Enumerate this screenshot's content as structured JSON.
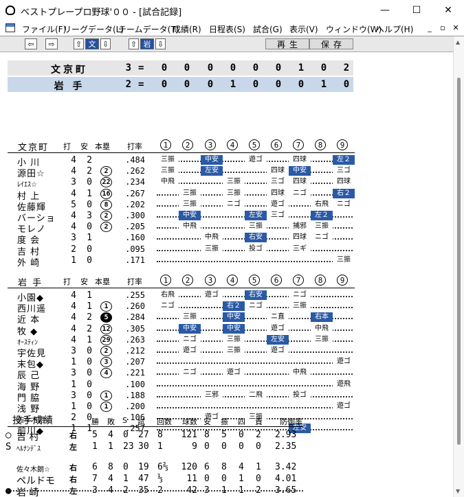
{
  "window": {
    "title": "ベストプレープロ野球'００ - [試合記録]",
    "controls": {
      "minimize": "—",
      "maximize": "☐",
      "close": "✕"
    }
  },
  "menu": [
    "ファイル(F)",
    "リーグデータ(L)",
    "チームデータ(T)",
    "成績(R)",
    "日程表(S)",
    "試合(G)",
    "表示(V)",
    "ウィンドウ(W)",
    "ヘルプ(H)"
  ],
  "mdi": {
    "minimize": "_",
    "restore": "▫",
    "close": "✕"
  },
  "toolbar": {
    "back": "⇦",
    "forward": "⇨",
    "up1": "⇧",
    "team1": "文",
    "down1": "⇩",
    "up2": "⇧",
    "team2": "岩",
    "down2": "⇩",
    "play": "再生",
    "save": "保存"
  },
  "scoreboard": [
    {
      "team": "文京町",
      "total": "3",
      "eq": "=",
      "innings": [
        "0",
        "0",
        "0",
        "0",
        "0",
        "0",
        "1",
        "0",
        "2"
      ]
    },
    {
      "team": "岩 手",
      "total": "2",
      "eq": "=",
      "innings": [
        "0",
        "0",
        "0",
        "1",
        "0",
        "0",
        "0",
        "1",
        "0"
      ]
    }
  ],
  "batting_headers": {
    "ab": "打",
    "h": "安",
    "hr": "本塁",
    "avg": "打率"
  },
  "inning_circles": [
    "1",
    "2",
    "3",
    "4",
    "5",
    "6",
    "7",
    "8",
    "9"
  ],
  "teams": [
    {
      "name": "文京町",
      "players": [
        {
          "name": "小 川",
          "ab": "4",
          "h": "2",
          "hr": "",
          "avg": ".484",
          "abs": [
            [
              "三振",
              0
            ],
            [
              "中安",
              1
            ],
            [
              "遊ゴ",
              0
            ],
            [
              "四球",
              0
            ],
            [
              "左２",
              1
            ]
          ]
        },
        {
          "name": "源田☆",
          "ab": "4",
          "h": "2",
          "hr": "2",
          "avg": ".262",
          "abs": [
            [
              "三振",
              0
            ],
            [
              "左安",
              1
            ],
            [
              "四球",
              0
            ],
            [
              "中安",
              1
            ],
            [
              "三ゴ",
              0
            ]
          ]
        },
        {
          "name": "ﾚｲｴｽ☆",
          "ab": "3",
          "h": "0",
          "hr": "22",
          "avg": ".234",
          "abs": [
            [
              "中飛",
              0
            ],
            [
              "三振",
              0
            ],
            [
              "三ゴ",
              0
            ],
            [
              "四球",
              0
            ],
            [
              "四球",
              0
            ]
          ]
        },
        {
          "name": "村 上",
          "ab": "4",
          "h": "1",
          "hr": "16",
          "avg": ".267",
          "abs": [
            [
              "三振",
              0
            ],
            [
              "三振",
              0
            ],
            [
              "四球",
              0
            ],
            [
              "ニゴ",
              0
            ],
            [
              "右２",
              1
            ]
          ]
        },
        {
          "name": "佐藤輝",
          "ab": "5",
          "h": "0",
          "hr": "8",
          "avg": ".202",
          "abs": [
            [
              "三振",
              0
            ],
            [
              "ニゴ",
              0
            ],
            [
              "遊ゴ",
              0
            ],
            [
              "右飛",
              0
            ],
            [
              "ニゴ",
              0
            ]
          ]
        },
        {
          "name": "バーショ",
          "ab": "4",
          "h": "3",
          "hr": "2",
          "avg": ".300",
          "abs": [
            [
              "中安",
              1
            ],
            [
              "左安",
              1
            ],
            [
              "三ゴ",
              0
            ],
            [
              "左２",
              1
            ]
          ]
        },
        {
          "name": "モレノ",
          "ab": "4",
          "h": "0",
          "hr": "2",
          "avg": ".205",
          "abs": [
            [
              "中飛",
              0
            ],
            [
              "三振",
              0
            ],
            [
              "捕邪",
              0
            ],
            [
              "三振",
              0
            ]
          ]
        },
        {
          "name": "度 会",
          "ab": "3",
          "h": "1",
          "hr": "",
          "avg": ".160",
          "abs": [
            [
              "中飛",
              0
            ],
            [
              "右安",
              1
            ],
            [
              "四球",
              0
            ],
            [
              "ニゴ",
              0
            ]
          ]
        },
        {
          "name": "吉 村",
          "ab": "2",
          "h": "0",
          "hr": "",
          "avg": ".095",
          "abs": [
            [
              "三振",
              0
            ],
            [
              "投ゴ",
              0
            ],
            [
              "三ギ",
              0
            ]
          ]
        },
        {
          "name": "外 崎",
          "ab": "1",
          "h": "0",
          "hr": "",
          "avg": ".171",
          "abs": [
            [
              "三振",
              0
            ]
          ]
        }
      ]
    },
    {
      "name": "岩 手",
      "players": [
        {
          "name": "小園◆",
          "ab": "4",
          "h": "1",
          "hr": "",
          "avg": ".255",
          "abs": [
            [
              "右飛",
              0
            ],
            [
              "遊ゴ",
              0
            ],
            [
              "右安",
              1
            ],
            [
              "ニゴ",
              0
            ]
          ]
        },
        {
          "name": "西川遥",
          "ab": "4",
          "h": "1",
          "hr": "1",
          "avg": ".260",
          "abs": [
            [
              "ニゴ",
              0
            ],
            [
              "右２",
              1
            ],
            [
              "ニゴ",
              0
            ],
            [
              "三振",
              0
            ]
          ]
        },
        {
          "name": "近 本",
          "ab": "4",
          "h": "2",
          "hr": "5",
          "avg": ".284",
          "abs": [
            [
              "三振",
              0
            ],
            [
              "中安",
              1
            ],
            [
              "ニ直",
              0
            ],
            [
              "右本",
              1
            ]
          ]
        },
        {
          "name": "牧 ◆",
          "ab": "4",
          "h": "2",
          "hr": "12",
          "avg": ".305",
          "abs": [
            [
              "中安",
              1
            ],
            [
              "中安",
              1
            ],
            [
              "遊ゴ",
              0
            ],
            [
              "中飛",
              0
            ]
          ]
        },
        {
          "name": "ｵｰｽﾃｨﾝ",
          "ab": "4",
          "h": "1",
          "hr": "29",
          "avg": ".263",
          "abs": [
            [
              "ニゴ",
              0
            ],
            [
              "三振",
              0
            ],
            [
              "左安",
              1
            ],
            [
              "三振",
              0
            ]
          ]
        },
        {
          "name": "宇佐見",
          "ab": "3",
          "h": "0",
          "hr": "2",
          "avg": ".212",
          "abs": [
            [
              "遊ゴ",
              0
            ],
            [
              "三振",
              0
            ],
            [
              "遊ゴ",
              0
            ]
          ]
        },
        {
          "name": "末包◆",
          "ab": "1",
          "h": "0",
          "hr": "3",
          "avg": ".207",
          "abs": [
            [
              "遊ゴ",
              0
            ]
          ]
        },
        {
          "name": "辰 己",
          "ab": "3",
          "h": "0",
          "hr": "4",
          "avg": ".221",
          "abs": [
            [
              "ニゴ",
              0
            ],
            [
              "遊ゴ",
              0
            ],
            [
              "中飛",
              0
            ]
          ]
        },
        {
          "name": "海 野",
          "ab": "1",
          "h": "0",
          "hr": "",
          "avg": ".100",
          "abs": [
            [
              "遊飛",
              0
            ]
          ]
        },
        {
          "name": "門 脇",
          "ab": "3",
          "h": "0",
          "hr": "1",
          "avg": ".188",
          "abs": [
            [
              "三邪",
              0
            ],
            [
              "二飛",
              0
            ],
            [
              "投ゴ",
              0
            ]
          ]
        },
        {
          "name": "浅 野",
          "ab": "1",
          "h": "0",
          "hr": "1",
          "avg": ".200",
          "abs": [
            [
              "遊ゴ",
              0
            ]
          ]
        },
        {
          "name": "佐々木朗☆",
          "ab": "2",
          "h": "0",
          "hr": "",
          "avg": ".106",
          "abs": [
            [
              "遊ゴ",
              0
            ],
            [
              "三振",
              0
            ]
          ]
        },
        {
          "name": "前川◆",
          "ab": "1",
          "h": "1",
          "hr": "",
          "avg": ".257",
          "abs": [
            [
              "左安",
              1
            ]
          ]
        }
      ]
    }
  ],
  "pitching": {
    "title": "投手成績",
    "headers": [
      "勝",
      "敗",
      "S",
      "試",
      "回数",
      "球数",
      "安",
      "振",
      "四",
      "責",
      "防御率"
    ],
    "rows": [
      {
        "mark": "○",
        "name": "吉 村",
        "hand": "右",
        "vals": [
          "5",
          "4",
          "0",
          "27",
          "8",
          "121",
          "8",
          "5",
          "0",
          "2",
          "2.93"
        ]
      },
      {
        "mark": "S",
        "name": "ﾍﾙﾅﾝﾃﾞｽ",
        "hand": "左",
        "vals": [
          "1",
          "1",
          "23",
          "30",
          "1",
          "9",
          "0",
          "0",
          "0",
          "0",
          "2.35"
        ]
      },
      {
        "mark": "",
        "name": "佐々木朗☆",
        "hand": "右",
        "vals": [
          "6",
          "8",
          "0",
          "19",
          "6⅔",
          "120",
          "6",
          "8",
          "4",
          "1",
          "3.42"
        ]
      },
      {
        "mark": "",
        "name": "ペルドモ",
        "hand": "右",
        "vals": [
          "7",
          "4",
          "1",
          "47",
          "⅓",
          "11",
          "0",
          "0",
          "1",
          "0",
          "4.01"
        ]
      },
      {
        "mark": "●",
        "name": "岩 崎",
        "hand": "左",
        "vals": [
          "3",
          "4",
          "2",
          "35",
          "2",
          "42",
          "3",
          "1",
          "1",
          "2",
          "3.65"
        ]
      }
    ]
  },
  "colors": {
    "hit_bg": "#2a5aa6",
    "visitor_row": "#e6e6e6",
    "home_row": "#c8d8ea",
    "selected_btn": "#2450a0"
  }
}
